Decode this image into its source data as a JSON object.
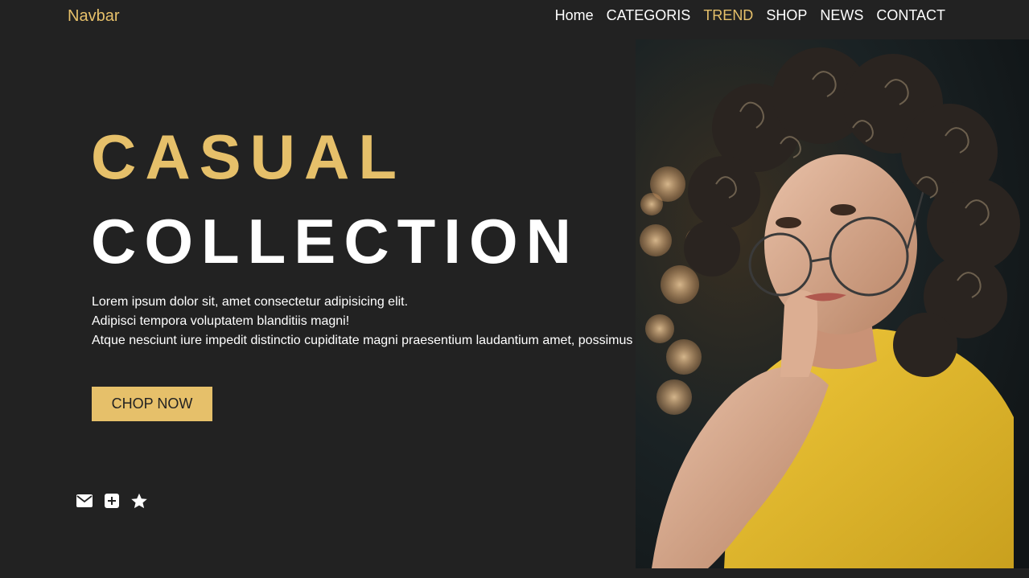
{
  "navbar": {
    "brand": "Navbar",
    "links": [
      "Home",
      "CATEGORIS",
      "TREND",
      "SHOP",
      "NEWS",
      "CONTACT"
    ],
    "active_index": 2
  },
  "hero": {
    "title_line1": "CASUAL",
    "title_line2": "COLLECTION",
    "description": [
      "Lorem ipsum dolor sit, amet consectetur adipisicing elit.",
      "Adipisci tempora voluptatem blanditiis magni!",
      "Atque nesciunt iure impedit distinctio cupiditate magni praesentium laudantium amet, possimus"
    ],
    "cta_label": "CHOP NOW"
  },
  "social_icons": [
    "envelope-icon",
    "plus-square-icon",
    "star-icon"
  ],
  "colors": {
    "background": "#222222",
    "accent": "#e6c06a",
    "text": "#ffffff"
  }
}
